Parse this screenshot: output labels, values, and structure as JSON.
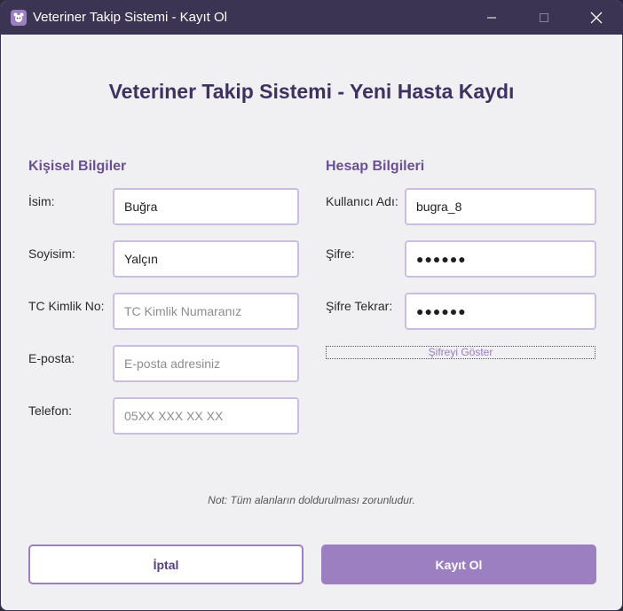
{
  "window": {
    "title": "Veteriner Takip Sistemi - Kayıt Ol",
    "icon": "app-pet-icon",
    "controls": [
      "minimize-icon",
      "maximize-icon",
      "close-icon"
    ]
  },
  "main": {
    "heading": "Veteriner Takip Sistemi - Yeni Hasta Kaydı"
  },
  "personal": {
    "section_title": "Kişisel Bilgiler",
    "name_label": "İsim:",
    "name_value": "Buğra",
    "surname_label": "Soyisim:",
    "surname_value": "Yalçın",
    "tc_label": "TC Kimlik No:",
    "tc_placeholder": "TC Kimlik Numaranız",
    "email_label": "E-posta:",
    "email_placeholder": "E-posta adresiniz",
    "phone_label": "Telefon:",
    "phone_placeholder": "05XX XXX XX XX"
  },
  "account": {
    "section_title": "Hesap Bilgileri",
    "username_label": "Kullanıcı Adı:",
    "username_value": "bugra_8",
    "password_label": "Şifre:",
    "password_value": "●●●●●●",
    "password_repeat_label": "Şifre Tekrar:",
    "password_repeat_value": "●●●●●●",
    "show_password_label": "Şifreyi Göster"
  },
  "footer": {
    "note": "Not: Tüm alanların doldurulması zorunludur.",
    "cancel_label": "İptal",
    "register_label": "Kayıt Ol"
  },
  "colors": {
    "titlebar": "#3b3553",
    "accent": "#9b7fc0",
    "heading": "#3f3160",
    "section": "#6b4f96",
    "field_border": "#cbbde2",
    "background": "#f0f0f2"
  }
}
